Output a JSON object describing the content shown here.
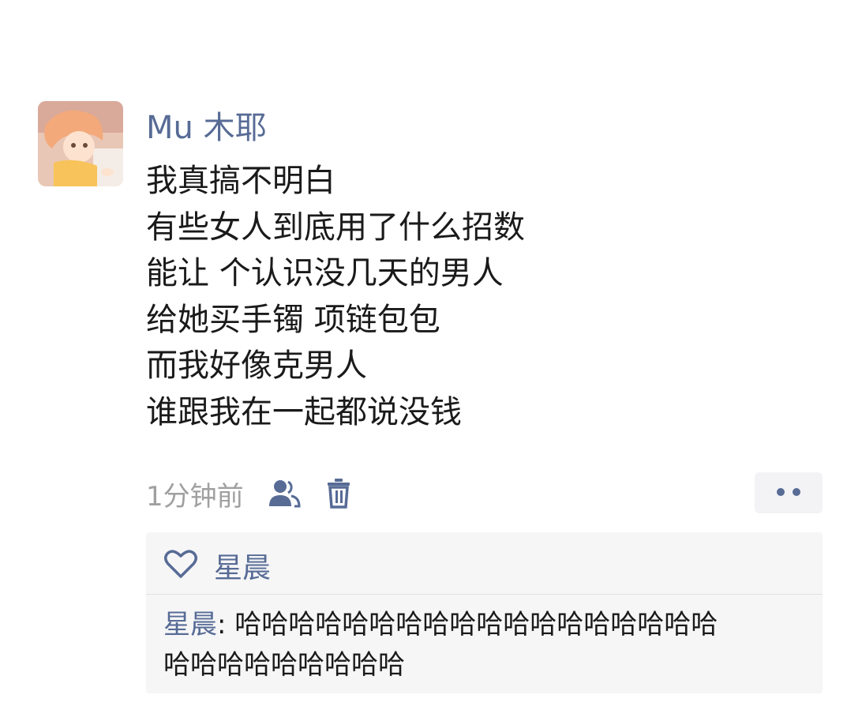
{
  "post": {
    "username": "Mu 木耶",
    "lines": [
      "我真搞不明白",
      "有些女人到底用了什么招数",
      "能让 个认识没几天的男人",
      "给她买手镯 项链包包",
      "而我好像克男人",
      "谁跟我在一起都说没钱"
    ],
    "timestamp": "1分钟前"
  },
  "likes": {
    "names": "星晨"
  },
  "comment": {
    "author": "星晨",
    "separator": ": ",
    "line1": "哈哈哈哈哈哈哈哈哈哈哈哈哈哈哈哈哈哈",
    "line2": "哈哈哈哈哈哈哈哈哈"
  },
  "icons": {
    "visibility": "people-icon",
    "delete": "trash-icon",
    "more": "more-dots-icon",
    "like": "heart-icon"
  },
  "colors": {
    "link_blue": "#576b95",
    "text": "#1a1a1a",
    "muted": "#a0a0a0",
    "panel": "#f6f6f7"
  }
}
